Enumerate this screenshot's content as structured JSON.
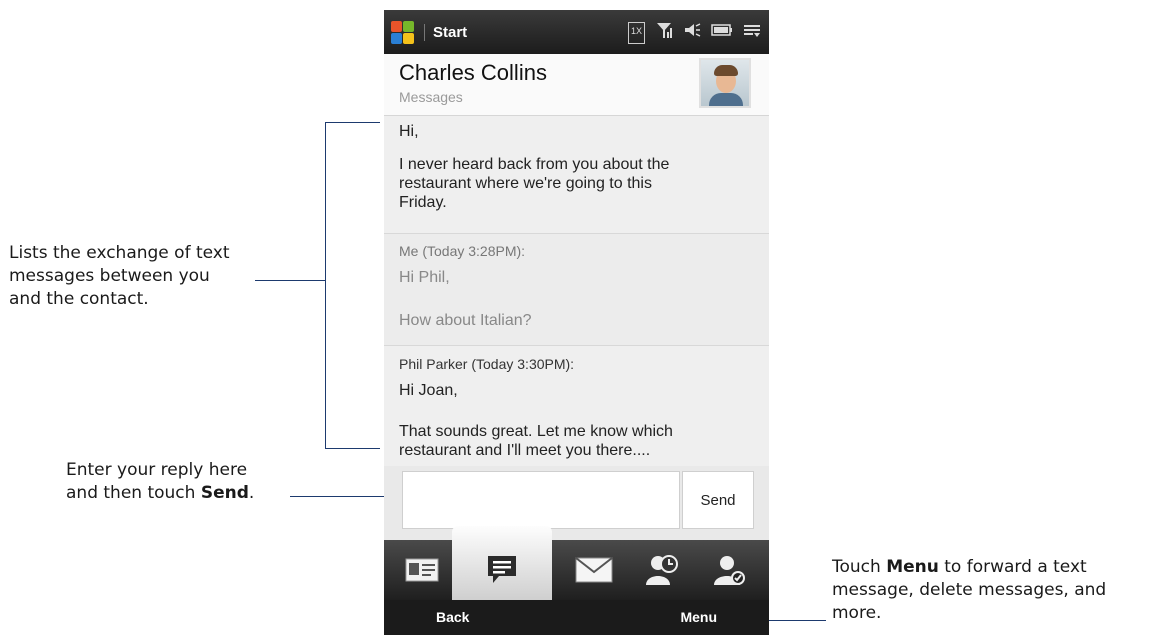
{
  "status_bar": {
    "start_label": "Start",
    "icons": [
      "1x-icon",
      "signal-icon",
      "speaker-icon",
      "battery-icon",
      "menu-icon"
    ],
    "box_label": "1X"
  },
  "header": {
    "name": "Charles Collins",
    "subtitle": "Messages"
  },
  "messages": {
    "m1_line1": "Hi,",
    "m1_body": [
      "I never heard back from you about the",
      "restaurant where we're going to this",
      "Friday."
    ],
    "m2_meta": "Me (Today 3:28PM):",
    "m2_line1": "Hi Phil,",
    "m2_line2": "How about Italian?",
    "m3_meta": "Phil Parker (Today 3:30PM):",
    "m3_line1": "Hi Joan,",
    "m3_body": [
      "That sounds great. Let me know which",
      "restaurant and I'll meet you there...."
    ]
  },
  "reply": {
    "send_label": "Send"
  },
  "tabs": [
    "contact-card-icon",
    "messages-icon",
    "email-icon",
    "updates-icon",
    "contact-settings-icon"
  ],
  "softkeys": {
    "back": "Back",
    "menu": "Menu"
  },
  "callouts": {
    "list": [
      "Lists the exchange of text",
      "messages between you",
      "and the contact."
    ],
    "reply_line1": "Enter your reply here",
    "reply_line2_pre": "and then touch ",
    "reply_line2_bold": "Send",
    "reply_line2_post": ".",
    "menu_pre": "Touch ",
    "menu_bold": "Menu",
    "menu_post": " to forward a text",
    "menu_line2": "message, delete messages, and",
    "menu_line3": "more."
  },
  "colors": {
    "callout_line": "#1d3a6e",
    "statusbar": "#2a2a2a",
    "background": "#f1f1f1"
  }
}
